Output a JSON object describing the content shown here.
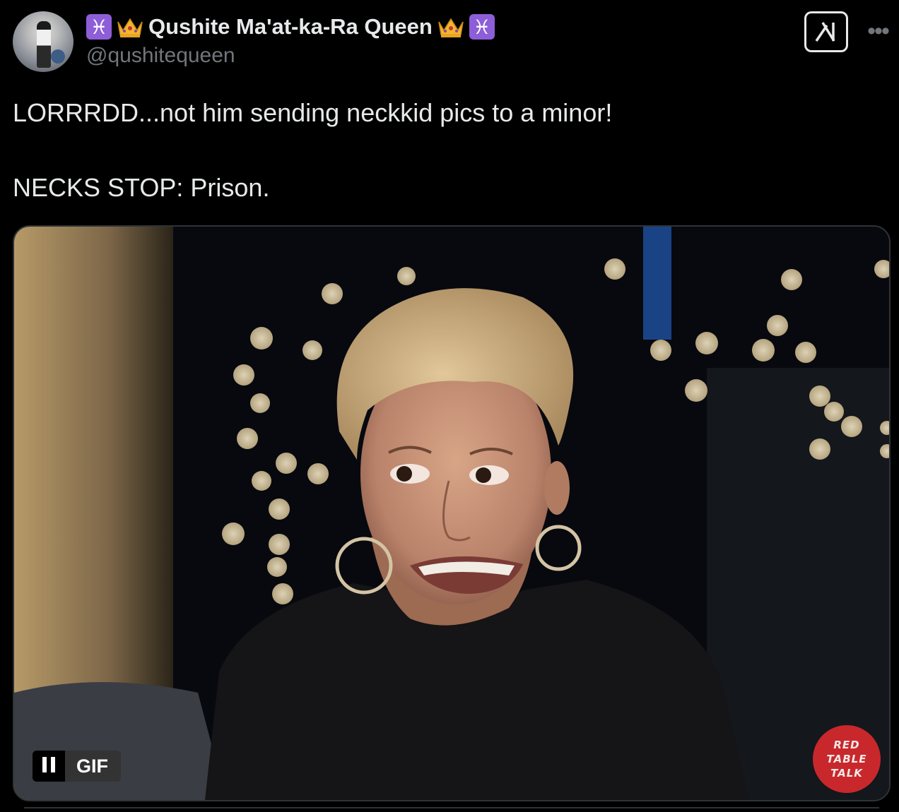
{
  "author": {
    "display_name": "Qushite Ma'at-ka-Ra Queen",
    "handle": "@qushitequeen",
    "name_emoji_outer": "♓",
    "crown_icon": "crown-emoji"
  },
  "tweet": {
    "line1": "LORRRDD...not him sending neckkid pics to a minor!",
    "line2": "NECKS STOP: Prison."
  },
  "media": {
    "badge_label": "GIF",
    "watermark": [
      "RED",
      "TABLE",
      "TALK"
    ]
  },
  "colors": {
    "background": "#000000",
    "text_primary": "#e7e9ea",
    "text_secondary": "#71767b",
    "pisces_bg": "#8e5ed8",
    "watermark_bg": "#c8282c",
    "border": "#2f3336"
  }
}
